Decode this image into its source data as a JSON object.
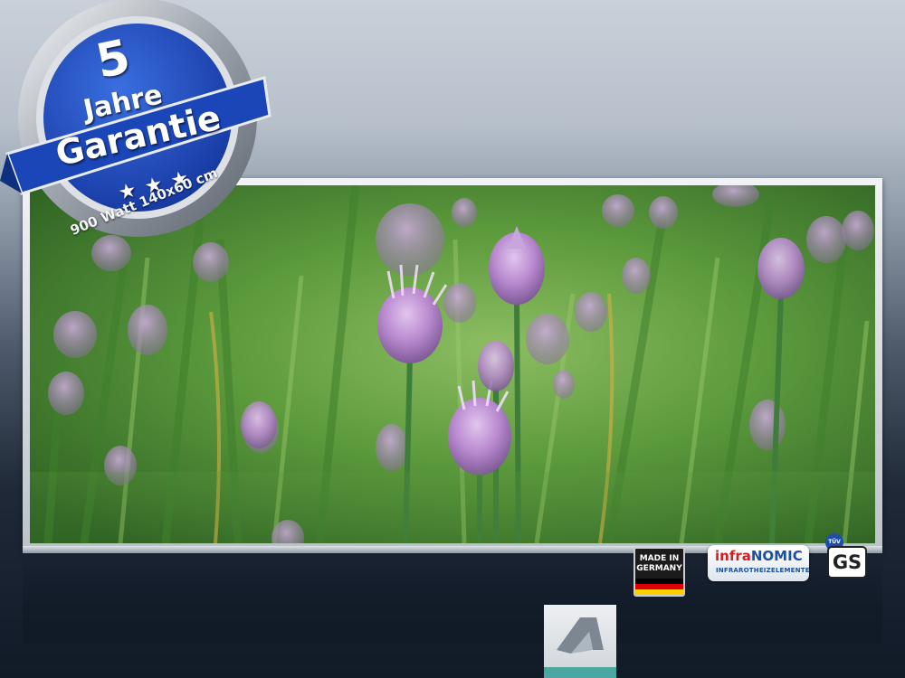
{
  "badge": {
    "number": "5",
    "year_label": "Jahre",
    "warranty_label": "Garantie",
    "stars": "★★★",
    "spec": "900 Watt 140x60 cm"
  },
  "logos": {
    "made_in_line1": "MADE IN",
    "made_in_line2": "GERMANY",
    "infra_brand_a": "infra",
    "infra_brand_b": "NOMIC",
    "infra_sub": "INFRAROTHEIZELEMENTE",
    "tuv": "TÜV",
    "gs": "GS"
  },
  "colors": {
    "badge_blue": "#1f4fc4",
    "ribbon_blue": "#1a46b8",
    "silver": "#c8ccd2",
    "accent_teal": "#4aa7a2"
  },
  "icons": {
    "brand_logo": "arrow-a-icon"
  }
}
